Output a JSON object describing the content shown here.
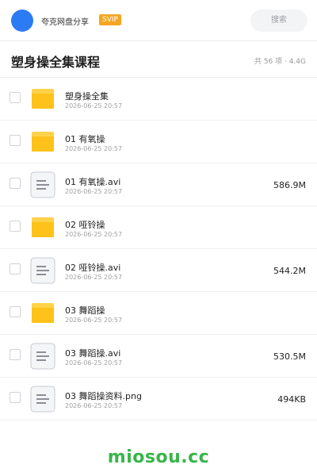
{
  "header": {
    "site_name": "夸克网盘分享",
    "badge": "SVIP",
    "search_placeholder": "搜索"
  },
  "share": {
    "title": "塑身操全集课程",
    "meta": "共 56 项 · 4.4G"
  },
  "files": [
    {
      "name": "塑身操全集",
      "date": "2026-06-25 20:57",
      "size": "",
      "type": "folder"
    },
    {
      "name": "01 有氧操",
      "date": "2026-06-25 20:57",
      "size": "",
      "type": "folder"
    },
    {
      "name": "01 有氧操.avi",
      "date": "2026-06-25 20:57",
      "size": "586.9M",
      "type": "file"
    },
    {
      "name": "02 哑铃操",
      "date": "2026-06-25 20:57",
      "size": "",
      "type": "folder"
    },
    {
      "name": "02 哑铃操.avi",
      "date": "2026-06-25 20:57",
      "size": "544.2M",
      "type": "file"
    },
    {
      "name": "03 舞蹈操",
      "date": "2026-06-25 20:57",
      "size": "",
      "type": "folder"
    },
    {
      "name": "03 舞蹈操.avi",
      "date": "2026-06-25 20:57",
      "size": "530.5M",
      "type": "file"
    },
    {
      "name": "03 舞蹈操资料.png",
      "date": "2026-06-25 20:57",
      "size": "494KB",
      "type": "file"
    }
  ],
  "watermark": "miosou.cc",
  "colors": {
    "accent": "#2b7bf5",
    "badge": "#f5a623",
    "folder": "#ffc21a",
    "watermark": "#37b54a"
  }
}
